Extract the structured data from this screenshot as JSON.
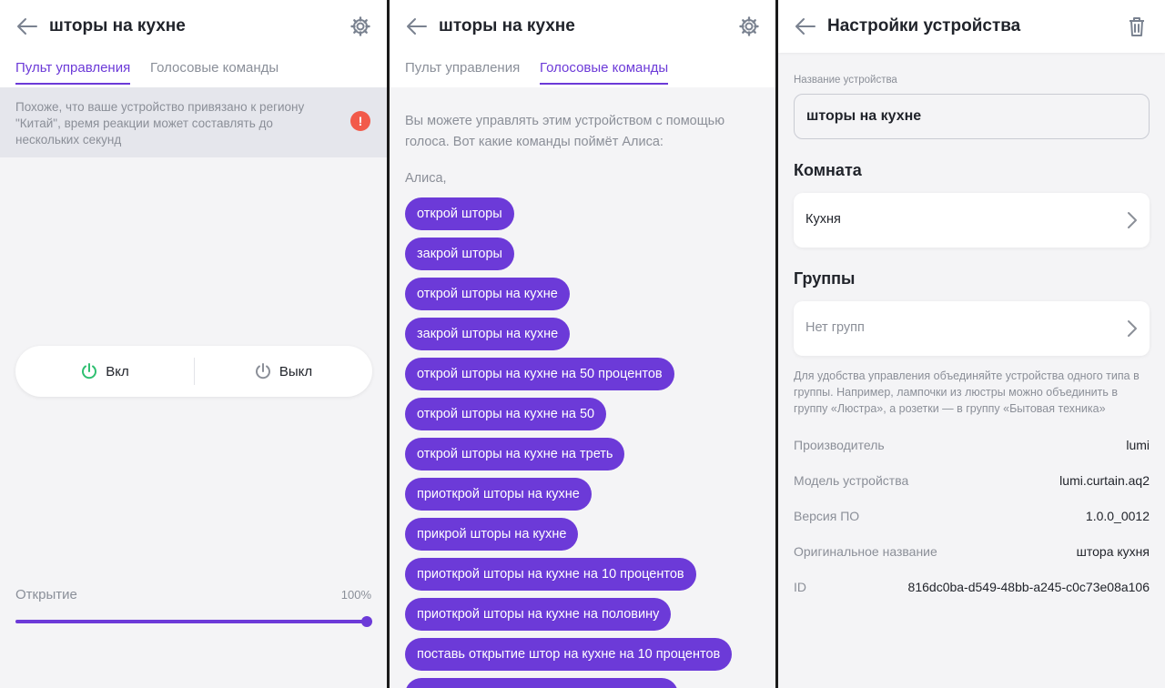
{
  "panel1": {
    "title": "шторы на кухне",
    "tabs": [
      {
        "label": "Пульт управления",
        "active": true
      },
      {
        "label": "Голосовые команды",
        "active": false
      }
    ],
    "notice": "Похоже, что ваше устройство привязано к региону \"Китай\", время реакции может составлять до нескольких секунд",
    "alert_glyph": "!",
    "power_on_label": "Вкл",
    "power_off_label": "Выкл",
    "slider_label": "Открытие",
    "slider_value_text": "100%",
    "slider_level": 1.0,
    "accent_color": "#6c3ad8",
    "on_icon_color": "#2fbf71",
    "off_icon_color": "#8b8f98"
  },
  "panel2": {
    "title": "шторы на кухне",
    "tabs": [
      {
        "label": "Пульт управления",
        "active": false
      },
      {
        "label": "Голосовые команды",
        "active": true
      }
    ],
    "intro": "Вы можете управлять этим устройством с помощью голоса. Вот какие команды поймёт Алиса:",
    "alice_prefix": "Алиса,",
    "commands": [
      "открой шторы",
      "закрой шторы",
      "открой шторы на кухне",
      "закрой шторы на кухне",
      "открой шторы на кухне на 50 процентов",
      "открой шторы на кухне на 50",
      "открой шторы на кухне на треть",
      "приоткрой шторы на кухне",
      "прикрой шторы на кухне",
      "приоткрой шторы на кухне на 10 процентов",
      "приоткрой шторы на кухне на половину",
      "поставь открытие штор на кухне на 10 процентов"
    ]
  },
  "panel3": {
    "title": "Настройки устройства",
    "name_label": "Название устройства",
    "name_value": "шторы на кухне",
    "room_title": "Комната",
    "room_value": "Кухня",
    "groups_title": "Группы",
    "groups_value": "Нет групп",
    "groups_hint": "Для удобства управления объединяйте устройства одного типа в группы. Например, лампочки из люстры можно объединить в группу «Люстра», а розетки — в группу «Бытовая техника»",
    "info": [
      {
        "key": "Производитель",
        "value": "lumi"
      },
      {
        "key": "Модель устройства",
        "value": "lumi.curtain.aq2"
      },
      {
        "key": "Версия ПО",
        "value": "1.0.0_0012"
      },
      {
        "key": "Оригинальное название",
        "value": "штора кухня"
      },
      {
        "key": "ID",
        "value": "816dc0ba-d549-48bb-a245-c0c73e08a106"
      }
    ]
  }
}
